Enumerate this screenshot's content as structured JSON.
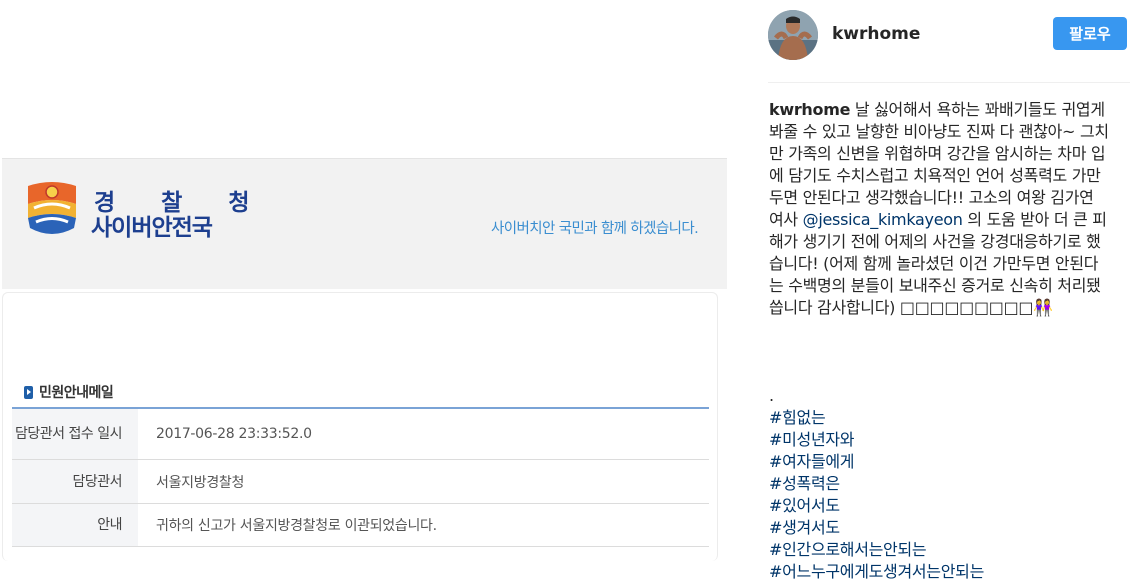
{
  "embedded_screenshot": {
    "logo": {
      "line1": "경 찰 청",
      "line2": "사이버안전국"
    },
    "slogan": "사이버치안 국민과 함께 하겠습니다.",
    "section_title": "민원안내메일",
    "table": [
      {
        "label": "담당관서 접수 일시",
        "value": "2017-06-28 23:33:52.0"
      },
      {
        "label": "담당관서",
        "value": "서울지방경찰청"
      },
      {
        "label": "안내",
        "value": "귀하의 신고가 서울지방경찰청로 이관되었습니다."
      }
    ]
  },
  "post": {
    "username": "kwrhome",
    "follow_label": "팔로우",
    "caption_author": "kwrhome",
    "caption_part1": " 날 싫어해서 욕하는 꽈배기들도 귀엽게 봐줄 수 있고 날향한 비아냥도 진짜 다 괜찮아~ 그치만 가족의 신변을 위협하며 강간을 암시하는 차마 입에 담기도 수치스럽고 치욕적인 언어 성폭력도 가만두면 안된다고 생각했습니다!! 고소의 여왕 김가연 여사 ",
    "caption_mention": "@jessica_kimkayeon",
    "caption_part2": " 의 도움 받아 더 큰 피해가 생기기 전에 어제의 사건을 강경대응하기로 했습니다! (어제 함께 놀라셨던 이건 가만두면 안된다는 수백명의 분들이 보내주신 증거로 신속히 처리됐씁니다 감사합니다) □□□□□□□□□👭",
    "dot": ".",
    "hashtags": [
      "#힘없는",
      "#미성년자와",
      "#여자들에게",
      "#성폭력은",
      "#있어서도",
      "#생겨서도",
      "#인간으로해서는안되는",
      "#어느누구에게도생겨서는안되는"
    ]
  },
  "colors": {
    "follow_button": "#3897f0",
    "link": "#003569",
    "police_blue": "#1d3f8f",
    "slogan": "#3b8ed0"
  }
}
